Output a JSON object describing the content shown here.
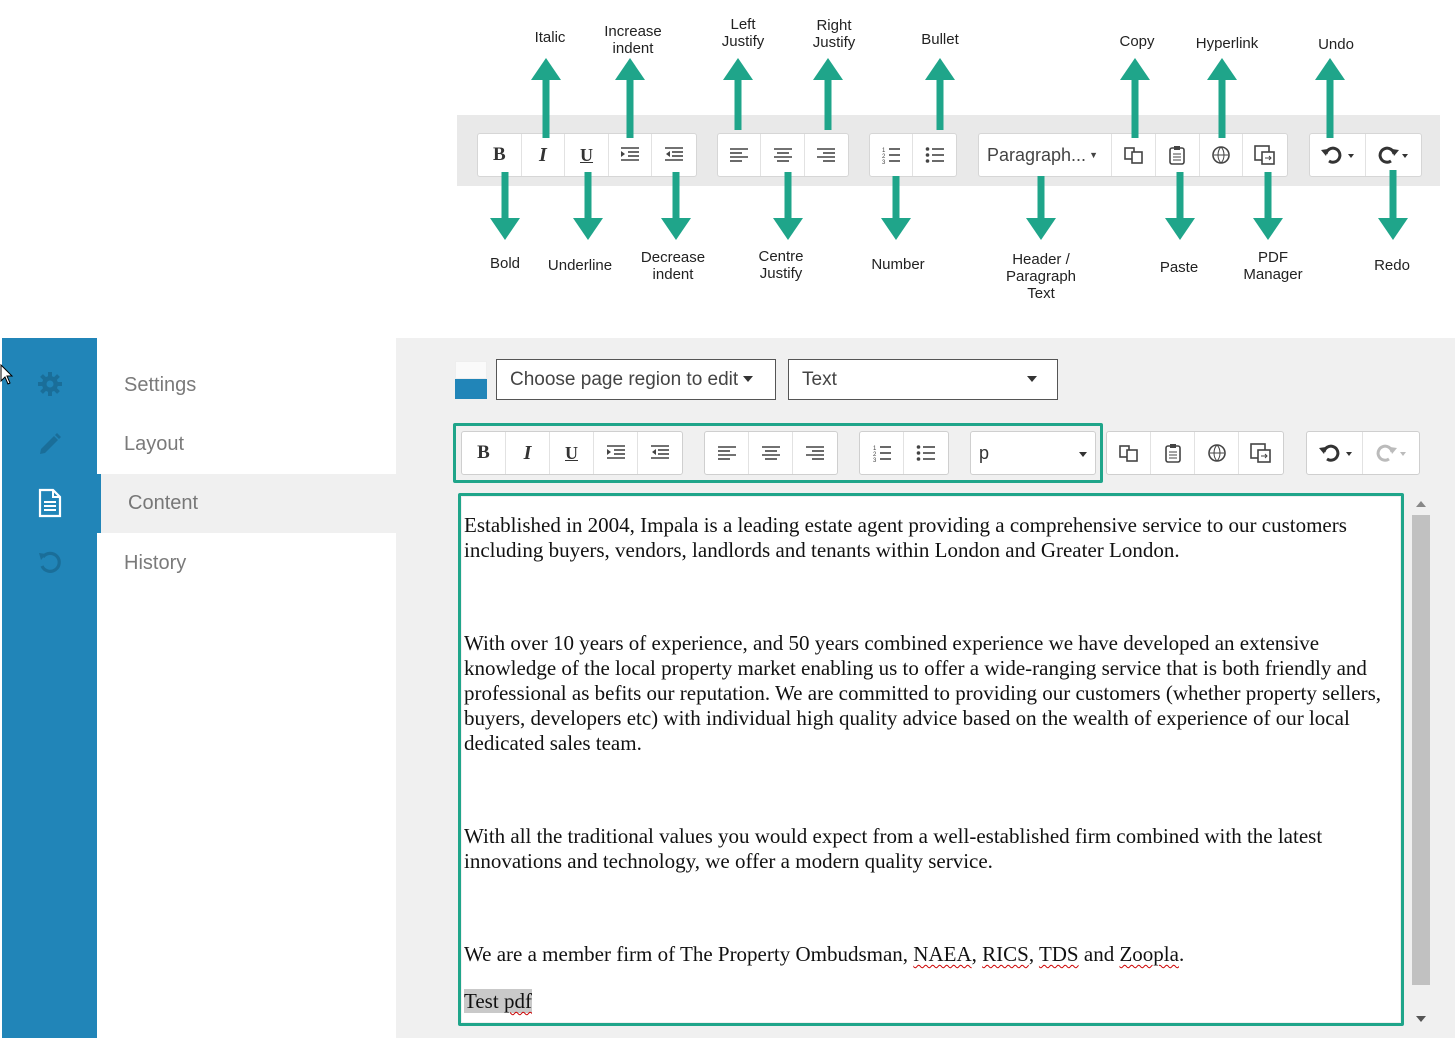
{
  "diagram": {
    "format_select": "Paragraph...",
    "labels_top": {
      "italic": "Italic",
      "increase_indent": "Increase\nindent",
      "left_justify": "Left\nJustify",
      "right_justify": "Right\nJustify",
      "bullet": "Bullet",
      "copy": "Copy",
      "hyperlink": "Hyperlink",
      "undo": "Undo"
    },
    "labels_bottom": {
      "bold": "Bold",
      "underline": "Underline",
      "decrease_indent": "Decrease\nindent",
      "centre_justify": "Centre\nJustify",
      "number": "Number",
      "header": "Header /\nParagraph\nText",
      "paste": "Paste",
      "pdf_manager": "PDF\nManager",
      "redo": "Redo"
    },
    "colors": {
      "arrow": "#1fa58a",
      "toolbar_bg": "#e9e9e9"
    }
  },
  "sidebar": {
    "icons": [
      "gear-icon",
      "pencil-icon",
      "document-icon",
      "history-icon"
    ],
    "items": [
      {
        "label": "Settings"
      },
      {
        "label": "Layout"
      },
      {
        "label": "Content",
        "active": true
      },
      {
        "label": "History"
      }
    ],
    "color": "#2185b8"
  },
  "editor": {
    "region_select": "Choose page region to edit",
    "type_select": "Text",
    "format_select": "p",
    "paragraphs": {
      "p1": "Established in 2004, Impala is a leading estate agent providing a comprehensive service to our customers including buyers, vendors, landlords and tenants within London and Greater London.",
      "p2": "With over 10 years of experience, and 50 years combined experience we have developed an extensive knowledge of the local property market enabling us to offer a wide-ranging service that is both friendly and professional as befits our reputation. We are committed to providing our customers (whether property sellers, buyers, developers etc) with individual high quality advice based on the wealth of experience of our local dedicated sales team.",
      "p3": "With all the traditional values you would expect from a well-established firm combined with the latest innovations and technology, we offer a modern quality service.",
      "p4_prefix": "We are a member firm of The Property Ombudsman, ",
      "p4_naea": "NAEA",
      "p4_sep1": ", ",
      "p4_rics": "RICS",
      "p4_sep2": ", ",
      "p4_tds": "TDS",
      "p4_and": " and ",
      "p4_zoopla": "Zoopla",
      "p4_end": ".",
      "p5_test": "Test ",
      "p5_pdf": "pdf"
    },
    "highlight_color": "#1fa58a"
  }
}
